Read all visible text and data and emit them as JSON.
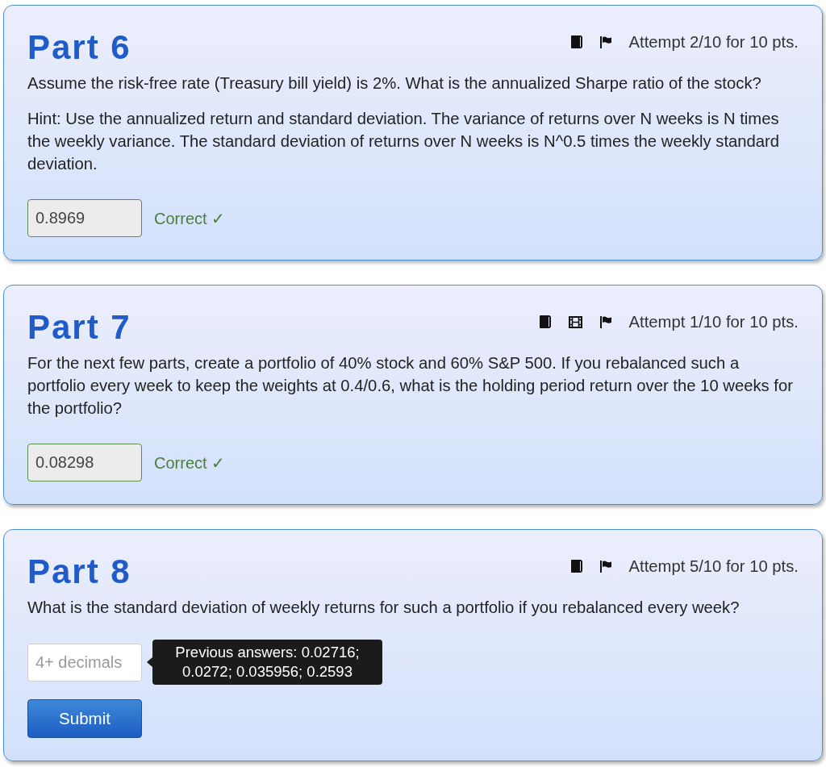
{
  "parts": [
    {
      "title": "Part 6",
      "icons": [
        {
          "kind": "book"
        },
        {
          "kind": "flag"
        }
      ],
      "attempt": "Attempt 2/10 for 10 pts.",
      "paragraphs": [
        "Assume the risk-free rate (Treasury bill yield) is 2%. What is the annualized Sharpe ratio of the stock?",
        "Hint: Use the annualized return and standard deviation. The variance of returns over N weeks is N times the weekly variance. The standard deviation of returns over N weeks is N^0.5 times the weekly standard deviation."
      ],
      "answer": {
        "value": "0.8969",
        "correct": true,
        "feedback": "Correct ✓"
      }
    },
    {
      "title": "Part 7",
      "icons": [
        {
          "kind": "book"
        },
        {
          "kind": "film"
        },
        {
          "kind": "flag"
        }
      ],
      "attempt": "Attempt 1/10 for 10 pts.",
      "paragraphs": [
        "For the next few parts, create a portfolio of 40% stock and 60% S&P 500. If you rebalanced such a portfolio every week to keep the weights at 0.4/0.6, what is the holding period return over the 10 weeks for the portfolio?"
      ],
      "answer": {
        "value": "0.08298",
        "correct": true,
        "feedback": "Correct ✓"
      }
    },
    {
      "title": "Part 8",
      "icons": [
        {
          "kind": "book"
        },
        {
          "kind": "flag"
        }
      ],
      "attempt": "Attempt 5/10 for 10 pts.",
      "paragraphs": [
        "What is the standard deviation of weekly returns for such a portfolio if you rebalanced every week?"
      ],
      "answer": {
        "placeholder": "4+ decimals",
        "correct": false,
        "tooltip": "Previous answers: 0.02716; 0.0272; 0.035956; 0.2593"
      },
      "submit": "Submit"
    }
  ]
}
